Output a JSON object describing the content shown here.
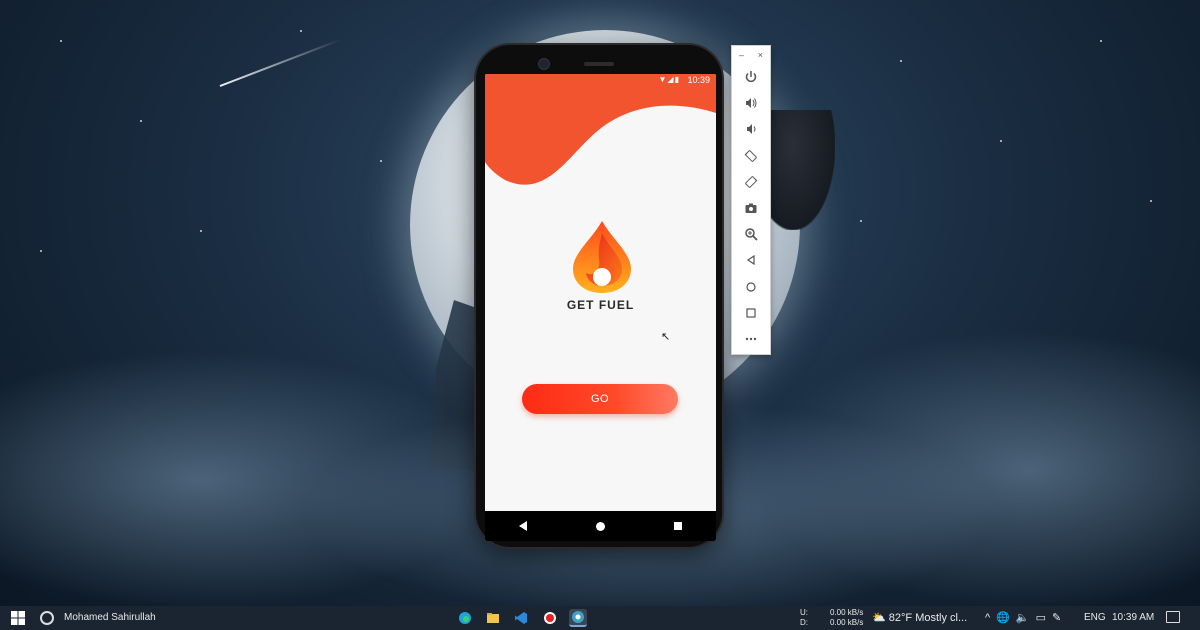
{
  "app": {
    "brand_name": "GET FUEL",
    "go_label": "GO",
    "status_time": "10:39",
    "accent_color": "#f1542f",
    "button_gradient": [
      "#ff2a14",
      "#ff7a62"
    ]
  },
  "phone_nav": {
    "back_icon": "triangle-back-icon",
    "home_icon": "circle-home-icon",
    "recents_icon": "square-recents-icon"
  },
  "emulator_toolbar": {
    "minimize": "–",
    "close": "×",
    "buttons": [
      "power-icon",
      "volume-up-icon",
      "volume-down-icon",
      "rotate-left-icon",
      "rotate-right-icon",
      "camera-icon",
      "zoom-icon",
      "back-icon",
      "home-icon",
      "overview-icon",
      "more-icon"
    ]
  },
  "taskbar": {
    "user": "Mohamed Sahirullah",
    "upload_label": "U:",
    "download_label": "D:",
    "upload_rate": "0.00 kB/s",
    "download_rate": "0.00 kB/s",
    "temperature": "82°F",
    "weather": "Mostly cl...",
    "language": "ENG",
    "time": "10:39 AM"
  }
}
